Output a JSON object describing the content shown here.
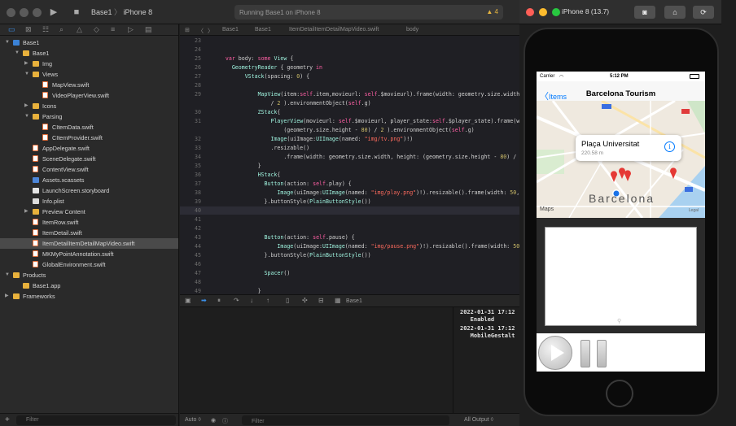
{
  "xcode": {
    "scheme": "Base1",
    "destination": "iPhone 8",
    "activity": "Running Base1 on iPhone 8",
    "warning_count": "4",
    "breadcrumb": [
      "Base1",
      "Base1",
      "ItemDetailItemDetailMapVideo.swift",
      "body"
    ]
  },
  "navigator": {
    "tree": [
      {
        "label": "Base1",
        "indent": 0,
        "icon": "project",
        "arrow": "down"
      },
      {
        "label": "Base1",
        "indent": 1,
        "icon": "folder",
        "arrow": "down"
      },
      {
        "label": "Img",
        "indent": 2,
        "icon": "folder",
        "arrow": "right"
      },
      {
        "label": "Views",
        "indent": 2,
        "icon": "folder",
        "arrow": "down"
      },
      {
        "label": "MapView.swift",
        "indent": 3,
        "icon": "swift",
        "arrow": ""
      },
      {
        "label": "VideoPlayerView.swift",
        "indent": 3,
        "icon": "swift",
        "arrow": ""
      },
      {
        "label": "Icons",
        "indent": 2,
        "icon": "folder",
        "arrow": "right"
      },
      {
        "label": "Parsing",
        "indent": 2,
        "icon": "folder",
        "arrow": "down"
      },
      {
        "label": "CItemData.swift",
        "indent": 3,
        "icon": "swift",
        "arrow": ""
      },
      {
        "label": "CItemProvider.swift",
        "indent": 3,
        "icon": "swift",
        "arrow": ""
      },
      {
        "label": "AppDelegate.swift",
        "indent": 2,
        "icon": "swift",
        "arrow": ""
      },
      {
        "label": "SceneDelegate.swift",
        "indent": 2,
        "icon": "swift",
        "arrow": ""
      },
      {
        "label": "ContentView.swift",
        "indent": 2,
        "icon": "swift",
        "arrow": ""
      },
      {
        "label": "Assets.xcassets",
        "indent": 2,
        "icon": "asset",
        "arrow": ""
      },
      {
        "label": "LaunchScreen.storyboard",
        "indent": 2,
        "icon": "story",
        "arrow": ""
      },
      {
        "label": "Info.plist",
        "indent": 2,
        "icon": "plist",
        "arrow": ""
      },
      {
        "label": "Preview Content",
        "indent": 2,
        "icon": "folder",
        "arrow": "right"
      },
      {
        "label": "ItemRow.swift",
        "indent": 2,
        "icon": "swift",
        "arrow": ""
      },
      {
        "label": "ItemDetail.swift",
        "indent": 2,
        "icon": "swift",
        "arrow": ""
      },
      {
        "label": "ItemDetailItemDetailMapVideo.swift",
        "indent": 2,
        "icon": "swift",
        "arrow": "",
        "selected": true
      },
      {
        "label": "MKMyPointAnnotation.swift",
        "indent": 2,
        "icon": "swift",
        "arrow": ""
      },
      {
        "label": "GlobalEnvironment.swift",
        "indent": 2,
        "icon": "swift",
        "arrow": ""
      },
      {
        "label": "Products",
        "indent": 0,
        "icon": "folder",
        "arrow": "down"
      },
      {
        "label": "Base1.app",
        "indent": 1,
        "icon": "app",
        "arrow": ""
      },
      {
        "label": "Frameworks",
        "indent": 0,
        "icon": "folder",
        "arrow": "right"
      }
    ],
    "filter_placeholder": "Filter"
  },
  "editor": {
    "lines": [
      {
        "n": "23",
        "code": ""
      },
      {
        "n": "24",
        "code": ""
      },
      {
        "n": "25",
        "code": "    <k>var</k> body: <k>some</k> <t>View</t> {"
      },
      {
        "n": "26",
        "code": "      <t>GeometryReader</t> { geometry <k>in</k>"
      },
      {
        "n": "27",
        "code": "          <t>VStack</t>(spacing: <n>0</n>) {"
      },
      {
        "n": "28",
        "code": ""
      },
      {
        "n": "29",
        "code": "              <t>MapView</t>(item:<k>self</k>.item,movieurl: <k>self</k>.$movieurl).frame(width: geometry.size.width, height: (geometry.size.height - <n>80</n>)"
      },
      {
        "n": "",
        "code": "                  / <n>2</n> ).environmentObject(<k>self</k>.g)"
      },
      {
        "n": "30",
        "code": "              <t>ZStack</t>{"
      },
      {
        "n": "31",
        "code": "                  <t>PlayerView</t>(movieurl: <k>self</k>.$movieurl, player_state:<k>self</k>.$player_state).frame(width: geometry.size.width, height:"
      },
      {
        "n": "",
        "code": "                      (geometry.size.height - <n>80</n>) / <n>2</n> ).environmentObject(<k>self</k>.g)"
      },
      {
        "n": "32",
        "code": "                  <t>Image</t>(uiImage:<t>UIImage</t>(named: <s>\"img/tv.png\"</s>)!)"
      },
      {
        "n": "33",
        "code": "                  .resizable()"
      },
      {
        "n": "34",
        "code": "                      .frame(width: geometry.size.width, height: (geometry.size.height - <n>80</n>) / <n>2</n>)"
      },
      {
        "n": "35",
        "code": "              }"
      },
      {
        "n": "36",
        "code": "              <t>HStack</t>{"
      },
      {
        "n": "37",
        "code": "                <t>Button</t>(action: <k>self</k>.play) {"
      },
      {
        "n": "38",
        "code": "                    <t>Image</t>(uiImage:<t>UIImage</t>(named: <s>\"img/play.png\"</s>)!).resizable().frame(width: <n>50</n>, height: <n>50</n>)"
      },
      {
        "n": "39",
        "code": "                }.buttonStyle(<t>PlainButtonStyle</t>())"
      },
      {
        "n": "40",
        "code": "",
        "current": true
      },
      {
        "n": "41",
        "code": ""
      },
      {
        "n": "42",
        "code": ""
      },
      {
        "n": "43",
        "code": "                <t>Button</t>(action: <k>self</k>.pause) {"
      },
      {
        "n": "44",
        "code": "                    <t>Image</t>(uiImage:<t>UIImage</t>(named: <s>\"img/pause.png\"</s>)!).resizable().frame(width: <n>50</n>, height: <n>50</n>)"
      },
      {
        "n": "45",
        "code": "                }.buttonStyle(<t>PlainButtonStyle</t>())"
      },
      {
        "n": "46",
        "code": ""
      },
      {
        "n": "47",
        "code": "                <t>Spacer</t>()"
      },
      {
        "n": "48",
        "code": ""
      },
      {
        "n": "49",
        "code": "              }"
      }
    ]
  },
  "debug": {
    "target": "Base1",
    "console": [
      "2022-01-31 17:12",
      "   Enabled",
      "2022-01-31 17:12",
      "   MobileGestalt"
    ],
    "console_trailing": "ion",
    "auto_label": "Auto ◊",
    "filter_placeholder": "Filter",
    "output_label": "All Output ◊"
  },
  "simulator": {
    "title": "iPhone 8 (13.7)",
    "carrier": "Carrier",
    "time": "5:12 PM",
    "back_label": "Items",
    "nav_title": "Barcelona Tourism",
    "callout_title": "Plaça Universitat",
    "callout_subtitle": "220.58 m",
    "map_city_label": "Barcelona",
    "maps_brand": "Maps",
    "legal": "Legal"
  },
  "colors": {
    "accent": "#007aff",
    "keyword": "#fc5fa3",
    "type": "#9ef1dd",
    "string": "#fc6a5d",
    "number": "#d0bf69"
  }
}
